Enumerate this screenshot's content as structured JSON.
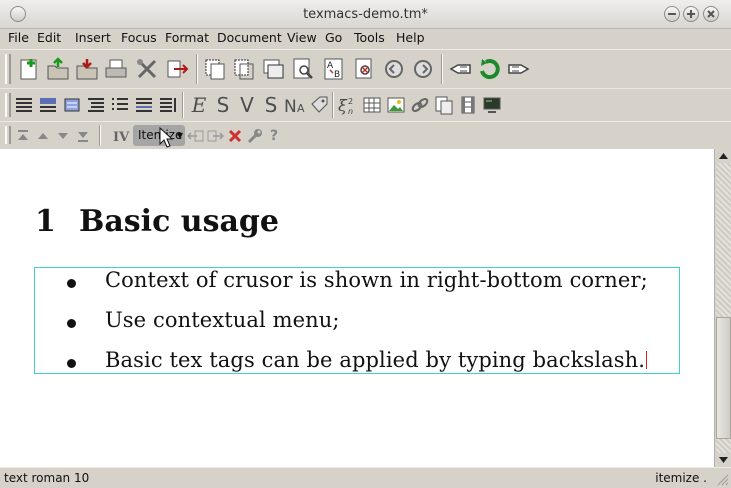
{
  "window": {
    "title": "texmacs-demo.tm*"
  },
  "menu": [
    "File",
    "Edit",
    "Insert",
    "Focus",
    "Format",
    "Document",
    "View",
    "Go",
    "Tools",
    "Help"
  ],
  "toolbar3": {
    "itemize_label": "Itemize"
  },
  "document": {
    "section_number": "1",
    "section_title": "Basic usage",
    "items": [
      "Context of crusor is shown in right-bottom corner;",
      "Use contextual menu;",
      "Basic tex tags can be applied by typing backslash."
    ]
  },
  "status": {
    "left": "text roman 10",
    "right": "itemize ."
  },
  "icons": {
    "toolbar1": [
      "new-document-icon",
      "open-icon",
      "save-icon",
      "print-icon",
      "preferences-icon",
      "export-icon",
      "copy-icon",
      "cut-icon",
      "paste-icon",
      "search-icon",
      "replace-icon",
      "spell-icon",
      "undo-icon",
      "redo-icon",
      "back-icon",
      "refresh-icon",
      "forward-icon"
    ],
    "toolbar2": [
      "align-left-icon",
      "paragraph-icon",
      "center-icon",
      "indent-icon",
      "list-icon",
      "numbered-list-icon",
      "description-list-icon",
      "emphasis-icon",
      "sans-serif-icon",
      "variant-icon",
      "strong-icon",
      "name-icon",
      "tag-icon",
      "math-icon",
      "table-icon",
      "image-icon",
      "link-icon",
      "footnote-icon",
      "animation-icon",
      "session-icon"
    ],
    "toolbar3": [
      "top-icon",
      "up-icon",
      "down-icon",
      "bottom-icon",
      "roman-numeral-icon",
      "chevron-down-icon",
      "exit-left-icon",
      "exit-right-icon",
      "delete-icon",
      "wrench-icon",
      "help-icon"
    ]
  },
  "colors": {
    "frame": "#40d0d0",
    "cursor": "#cc2222",
    "chrome": "#d6d2ca"
  }
}
